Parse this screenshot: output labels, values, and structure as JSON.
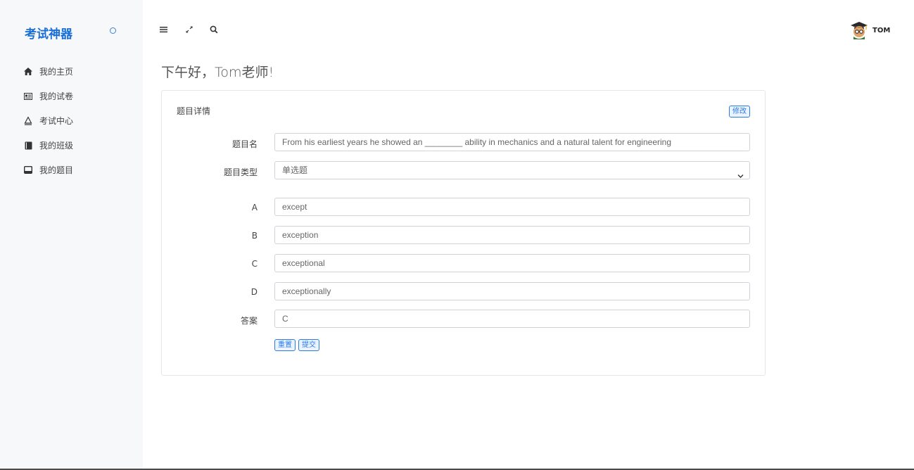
{
  "brand": {
    "name": "考试神器",
    "toggle_icon": "circle-icon"
  },
  "sidebar": {
    "items": [
      {
        "label": "我的主页",
        "icon": "home-icon"
      },
      {
        "label": "我的试卷",
        "icon": "newspaper-icon"
      },
      {
        "label": "考试中心",
        "icon": "exam-icon"
      },
      {
        "label": "我的班级",
        "icon": "book-icon"
      },
      {
        "label": "我的题目",
        "icon": "inbox-icon"
      }
    ]
  },
  "topbar": {
    "icons": [
      "menu-icon",
      "expand-icon",
      "search-icon"
    ],
    "user": {
      "name": "TOM",
      "avatar": "scholar-avatar"
    }
  },
  "greeting": "下午好，Tom老师!",
  "card": {
    "title": "题目详情",
    "edit_label": "修改",
    "fields": {
      "name_label": "题目名",
      "name_value": "From his earliest years he showed an ________ ability in mechanics and a natural talent for engineering",
      "type_label": "题目类型",
      "type_value": "单选题",
      "options": [
        {
          "label": "A",
          "value": "except"
        },
        {
          "label": "B",
          "value": "exception"
        },
        {
          "label": "C",
          "value": "exceptional"
        },
        {
          "label": "D",
          "value": "exceptionally"
        }
      ],
      "answer_label": "答案",
      "answer_value": "C"
    },
    "reset_label": "重置",
    "submit_label": "提交"
  },
  "colors": {
    "accent": "#2c7be5",
    "brand": "#1a6fd6",
    "sidebar_bg": "#f7f8fa"
  }
}
